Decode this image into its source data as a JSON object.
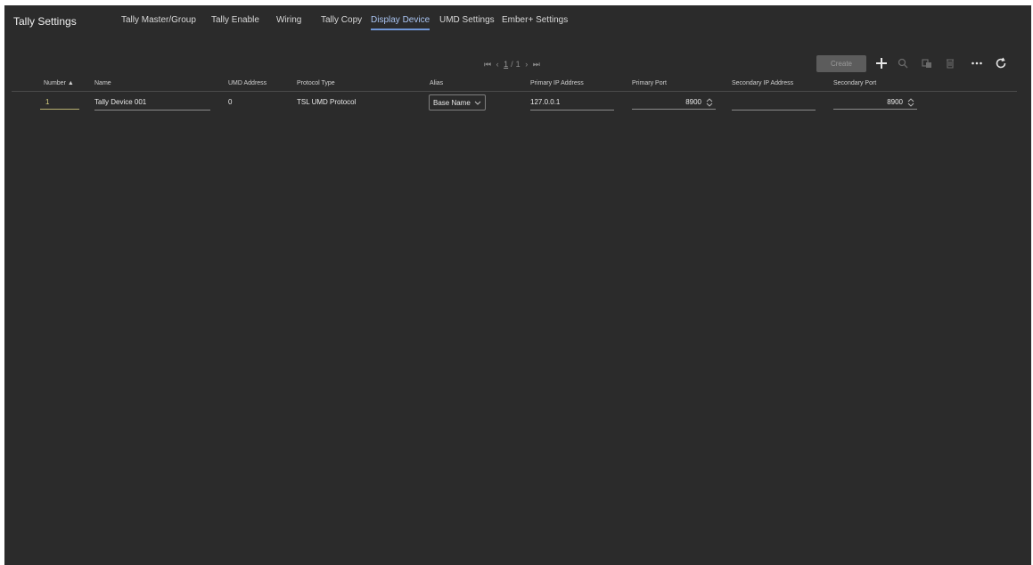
{
  "app": {
    "title": "Tally Settings"
  },
  "tabs": [
    {
      "label": "Tally Master/Group",
      "active": false
    },
    {
      "label": "Tally Enable",
      "active": false
    },
    {
      "label": "Wiring",
      "active": false
    },
    {
      "label": "Tally Copy",
      "active": false
    },
    {
      "label": "Display Device",
      "active": true
    },
    {
      "label": "UMD Settings",
      "active": false
    },
    {
      "label": "Ember+ Settings",
      "active": false
    }
  ],
  "pager": {
    "first": "⏮",
    "prev": "‹",
    "current": "1",
    "separator": "/",
    "total": "1",
    "next": "›",
    "last": "⏭"
  },
  "toolbar": {
    "create_label": "Create",
    "icons": [
      "add-icon",
      "search-icon",
      "copy-icon",
      "delete-icon",
      "more-icon",
      "refresh-icon"
    ]
  },
  "table": {
    "columns": [
      "Number ▲",
      "Name",
      "UMD Address",
      "Protocol Type",
      "Alias",
      "Primary IP Address",
      "Primary Port",
      "Secondary IP Address",
      "Secondary Port"
    ],
    "rows": [
      {
        "number": "1",
        "name": "Tally Device 001",
        "umd_address": "0",
        "protocol_type": "TSL UMD Protocol",
        "alias": "Base Name",
        "primary_ip": "127.0.0.1",
        "primary_port": "8900",
        "secondary_ip": "",
        "secondary_port": "8900"
      }
    ]
  },
  "colors": {
    "background": "#2b2b2b",
    "active_tab": "#6f96d6",
    "number_accent": "#d8d080"
  }
}
